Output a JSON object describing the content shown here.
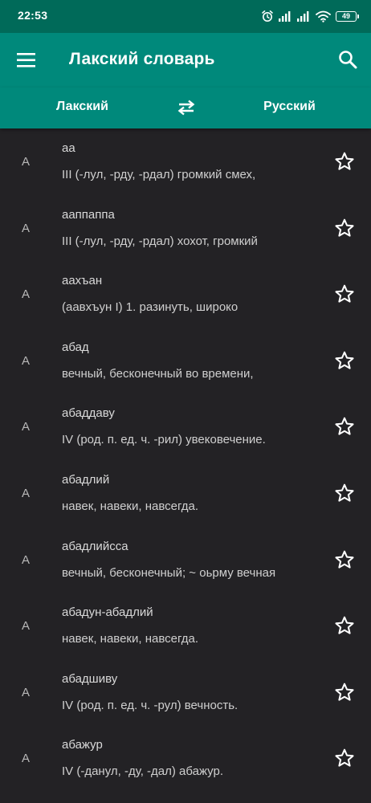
{
  "status_bar": {
    "time": "22:53",
    "battery": "49",
    "icons": [
      "alarm-icon",
      "signal-icon",
      "signal-icon",
      "wifi-icon",
      "battery-icon"
    ]
  },
  "toolbar": {
    "title": "Лакский словарь",
    "menu_icon": "menu-icon",
    "search_icon": "search-icon"
  },
  "lang_bar": {
    "from": "Лакский",
    "to": "Русский",
    "swap_icon": "swap-icon"
  },
  "entries": [
    {
      "letter": "А",
      "word": "аа",
      "definition": "III (-лул, -рду, -рдал) громкий смех,"
    },
    {
      "letter": "А",
      "word": "ааппаппа",
      "definition": "III (-лул, -рду, -рдал) хохот, громкий"
    },
    {
      "letter": "А",
      "word": "аахъан",
      "definition": "(аавхъун I) 1. разинуть, широко"
    },
    {
      "letter": "А",
      "word": "абад",
      "definition": "вечный, бесконечный во времени,"
    },
    {
      "letter": "А",
      "word": "абаддаву",
      "definition": "IV (род. п. ед. ч. -рил) увековечение."
    },
    {
      "letter": "А",
      "word": "абадлий",
      "definition": "навек, навеки, навсегда."
    },
    {
      "letter": "А",
      "word": "абадлийсса",
      "definition": "вечный, бесконечный; ~ оьрму вечная"
    },
    {
      "letter": "А",
      "word": "абадун-абадлий",
      "definition": "навек, навеки, навсегда."
    },
    {
      "letter": "А",
      "word": "абадшиву",
      "definition": "IV (род. п. ед. ч. -рул) вечность."
    },
    {
      "letter": "А",
      "word": "абажур",
      "definition": "IV (-данул, -ду, -дал) абажур."
    }
  ],
  "colors": {
    "status_bar": "#006a59",
    "toolbar": "#00897b",
    "background": "#232225"
  }
}
